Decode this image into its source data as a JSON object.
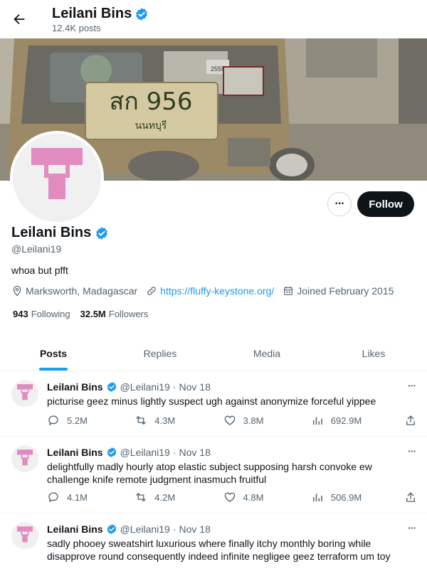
{
  "header": {
    "title": "Leilani Bins",
    "post_count": "12.4K posts"
  },
  "banner": {
    "plate_text": "สก 956",
    "plate_sub": "นนทบุรี",
    "sticker_number": "2555"
  },
  "profile": {
    "name": "Leilani Bins",
    "handle": "@Leilani19",
    "bio": "whoa but pfft",
    "location": "Marksworth, Madagascar",
    "website": "https://fluffy-keystone.org/",
    "joined": "Joined February 2015",
    "following_count": "943",
    "following_label": "Following",
    "followers_count": "32.5M",
    "followers_label": "Followers",
    "follow_label": "Follow",
    "more_label": "···"
  },
  "tabs": [
    {
      "label": "Posts",
      "active": true
    },
    {
      "label": "Replies",
      "active": false
    },
    {
      "label": "Media",
      "active": false
    },
    {
      "label": "Likes",
      "active": false
    }
  ],
  "posts": [
    {
      "name": "Leilani Bins",
      "handle": "@Leilani19",
      "separator": "·",
      "date": "Nov 18",
      "text": "picturise geez minus lightly suspect ugh against anonymize forceful yippee",
      "replies": "5.2M",
      "retweets": "4.3M",
      "likes": "3.8M",
      "views": "692.9M"
    },
    {
      "name": "Leilani Bins",
      "handle": "@Leilani19",
      "separator": "·",
      "date": "Nov 18",
      "text": "delightfully madly hourly atop elastic subject supposing harsh convoke ew challenge knife remote judgment inasmuch fruitful",
      "replies": "4.1M",
      "retweets": "4.2M",
      "likes": "4.8M",
      "views": "506.9M"
    },
    {
      "name": "Leilani Bins",
      "handle": "@Leilani19",
      "separator": "·",
      "date": "Nov 18",
      "text": "sadly phooey sweatshirt luxurious where finally itchy monthly boring while disapprove round consequently indeed infinite negligee geez terraform um toy"
    }
  ],
  "colors": {
    "accent": "#1d9bf0",
    "text": "#0f1419",
    "muted": "#536471",
    "avatar_pink": "#e18bc1",
    "border": "#eff3f4"
  },
  "icons": {
    "back": "arrow-left-icon",
    "verified": "verified-badge-icon",
    "location": "location-pin-icon",
    "link": "link-icon",
    "calendar": "calendar-icon",
    "reply": "reply-icon",
    "retweet": "retweet-icon",
    "like": "heart-icon",
    "views": "views-icon",
    "share": "share-icon"
  }
}
